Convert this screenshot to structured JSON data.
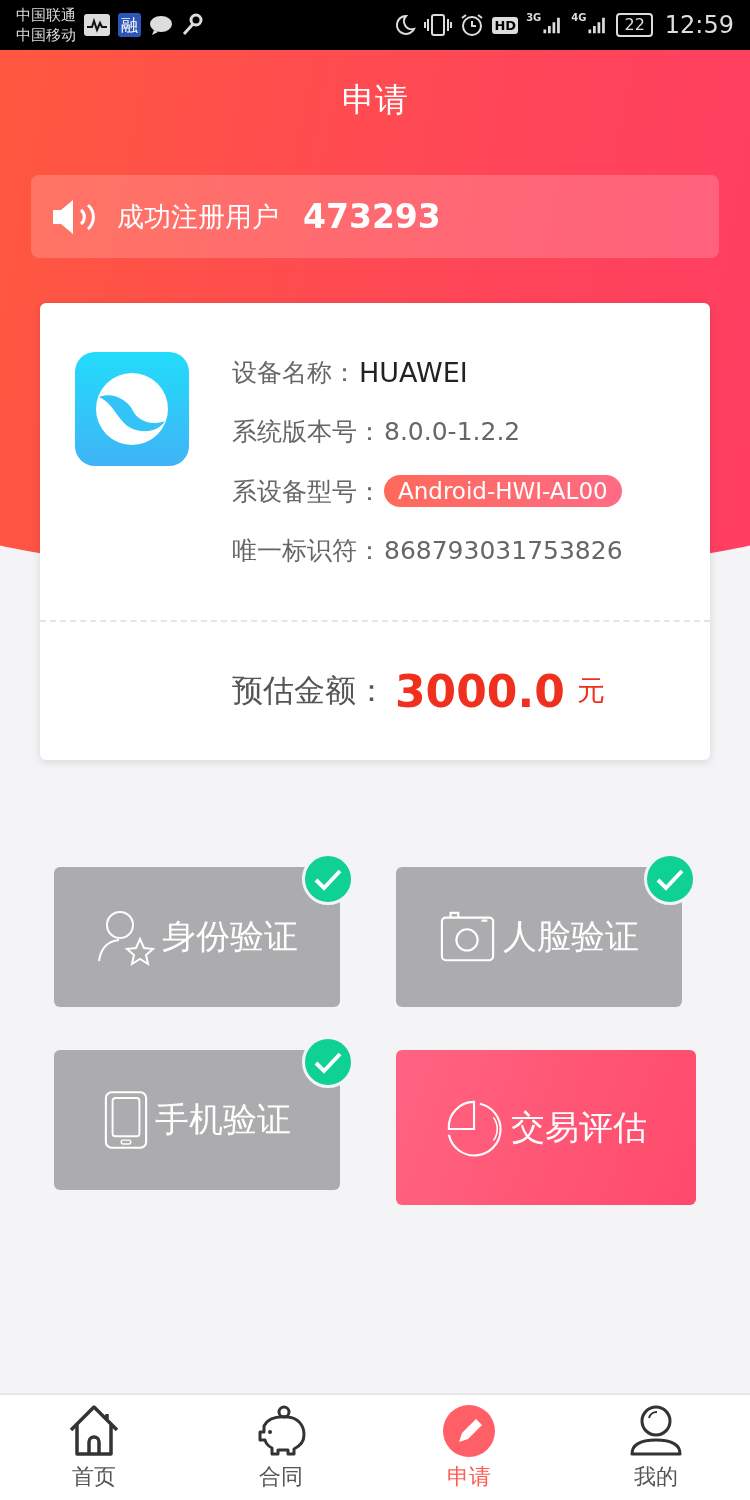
{
  "status_bar": {
    "carriers": [
      "中国联通",
      "中国移动"
    ],
    "app_badge": "融",
    "hd": "HD",
    "net_3g": "3G",
    "net_4g": "4G",
    "battery": "22",
    "time": "12:59"
  },
  "header": {
    "title": "申请"
  },
  "notice": {
    "label": "成功注册用户",
    "count": "473293"
  },
  "device_card": {
    "rows": [
      {
        "kind": "text",
        "label": "设备名称：",
        "value": "HUAWEI",
        "dark": true
      },
      {
        "kind": "text",
        "label": "系统版本号：",
        "value": "8.0.0-1.2.2",
        "dark": false
      },
      {
        "kind": "tag",
        "label": "系设备型号：",
        "value": "Android-HWI-AL00",
        "dark": false
      },
      {
        "kind": "text",
        "label": "唯一标识符：",
        "value": "868793031753826",
        "dark": false
      }
    ],
    "estimate": {
      "label": "预估金额：",
      "amount": "3000.0",
      "unit": "元"
    }
  },
  "tiles": [
    {
      "kind": "identity",
      "label": "身份验证",
      "checked": true
    },
    {
      "kind": "face",
      "label": "人脸验证",
      "checked": true
    },
    {
      "kind": "phone",
      "label": "手机验证",
      "checked": true
    },
    {
      "kind": "evaluate",
      "label": "交易评估",
      "checked": false
    }
  ],
  "tab_bar": [
    {
      "label": "首页",
      "selected": false
    },
    {
      "label": "合同",
      "selected": false
    },
    {
      "label": "申请",
      "selected": true
    },
    {
      "label": "我的",
      "selected": false
    }
  ]
}
